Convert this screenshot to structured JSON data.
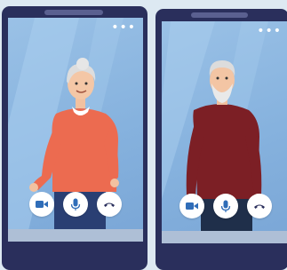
{
  "colors": {
    "phone_frame": "#2a2f5c",
    "screen_bg": "#8fb8e1",
    "button_bg": "#ffffff",
    "icon_blue": "#2f6db8",
    "icon_dark": "#2a2f5c"
  },
  "calls": [
    {
      "menu_icon": "more-dots-icon",
      "menu_glyph": "•••",
      "person": "elderly-woman",
      "controls": [
        "video-camera-icon",
        "microphone-icon",
        "hang-up-phone-icon"
      ]
    },
    {
      "menu_icon": "more-dots-icon",
      "menu_glyph": "•••",
      "person": "elderly-man",
      "controls": [
        "video-camera-icon",
        "microphone-icon",
        "hang-up-phone-icon"
      ]
    }
  ]
}
